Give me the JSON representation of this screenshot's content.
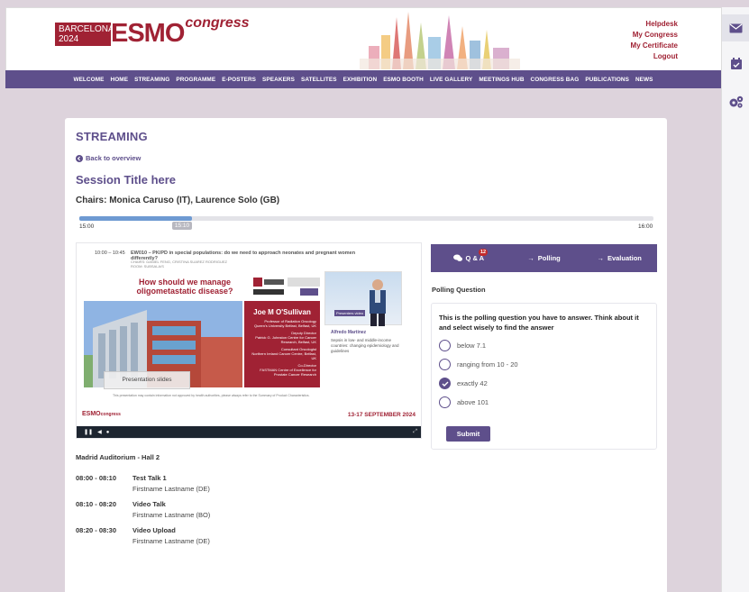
{
  "header": {
    "city": "BARCELONA",
    "year": "2024",
    "brand": "ESMO",
    "brand_suffix": "congress",
    "links": [
      "Helpdesk",
      "My Congress",
      "My Certificate",
      "Logout"
    ]
  },
  "nav": [
    "WELCOME",
    "HOME",
    "STREAMING",
    "PROGRAMME",
    "E-POSTERS",
    "SPEAKERS",
    "SATELLITES",
    "EXHIBITION",
    "ESMO BOOTH",
    "LIVE GALLERY",
    "MEETINGS HUB",
    "CONGRESS BAG",
    "PUBLICATIONS",
    "NEWS"
  ],
  "sidebar": {
    "icons": [
      "mail-icon",
      "calendar-check-icon",
      "settings-icon"
    ]
  },
  "page": {
    "title": "STREAMING",
    "back_label": "Back to overview",
    "session_title": "Session Title here",
    "chairs": "Chairs: Monica Caruso (IT), Laurence Solo (GB)"
  },
  "timeline": {
    "start": "15:00",
    "end": "16:00",
    "current": "15:10",
    "progress": 0.196
  },
  "video": {
    "slide_time": "10:00 – 10:45",
    "slide_title": "EW010 – PK/PD in special populations: do we need to approach neonates and pregnant women differently?",
    "slide_chairs": "CHAIRS: DANIEL FENG, CRISTINA SUAREZ RODRIGUEZ",
    "slide_room": "ROOM: SUBSALA/S",
    "slide_question": "How should we manage oligometastatic disease?",
    "speaker_name": "Joe M O'Sullivan",
    "speaker_role1": "Professor of Radiation Oncology",
    "speaker_inst1": "Queen's University Belfast, Belfast, UK",
    "speaker_role2": "Deputy Director",
    "speaker_inst2": "Patrick G. Johnston Centre for Cancer Research, Belfast, UK",
    "speaker_role3": "Consultant Oncologist",
    "speaker_inst3": "Northern Ireland Cancer Centre, Belfast, UK",
    "speaker_role4": "Co-Director",
    "speaker_inst4": "FASTMAN Centre of Excellence for Prostate Cancer Research",
    "pip_label": "Presenters video",
    "pip_name": "Alfredo Martinez",
    "pip_topic": "Sepsis in low- and middle-income countries: changing epidemiology and guidelines",
    "slides_button": "Presentation slides",
    "footer_note": "This presentation may contain information not approved by health authorities, please always refer to the Summary of Product Characteristics.",
    "footer_dates": "13-17 SEPTEMBER 2024"
  },
  "tabs": [
    {
      "label": "Q & A",
      "badge": "12"
    },
    {
      "label": "Polling"
    },
    {
      "label": "Evaluation"
    }
  ],
  "poll": {
    "label": "Polling Question",
    "question": "This is the polling question you have to answer. Think about it and select wisely to find the answer",
    "options": [
      "below 7.1",
      "ranging from 10 - 20",
      "exactly 42",
      "above 101"
    ],
    "selected_index": 2,
    "submit": "Submit"
  },
  "schedule": {
    "room": "Madrid Auditorium - Hall 2",
    "items": [
      {
        "time": "08:00 - 08:10",
        "title": "Test Talk 1",
        "speaker": "Firstname Lastname (DE)"
      },
      {
        "time": "08:10 - 08:20",
        "title": "Video Talk",
        "speaker": "Firstname Lastname (BO)"
      },
      {
        "time": "08:20 - 08:30",
        "title": "Video Upload",
        "speaker": "Firstname Lastname (DE)"
      }
    ]
  },
  "colors": {
    "brand_red": "#a02234",
    "purple": "#5e4f8b",
    "timeline_blue": "#6e9ad2"
  }
}
